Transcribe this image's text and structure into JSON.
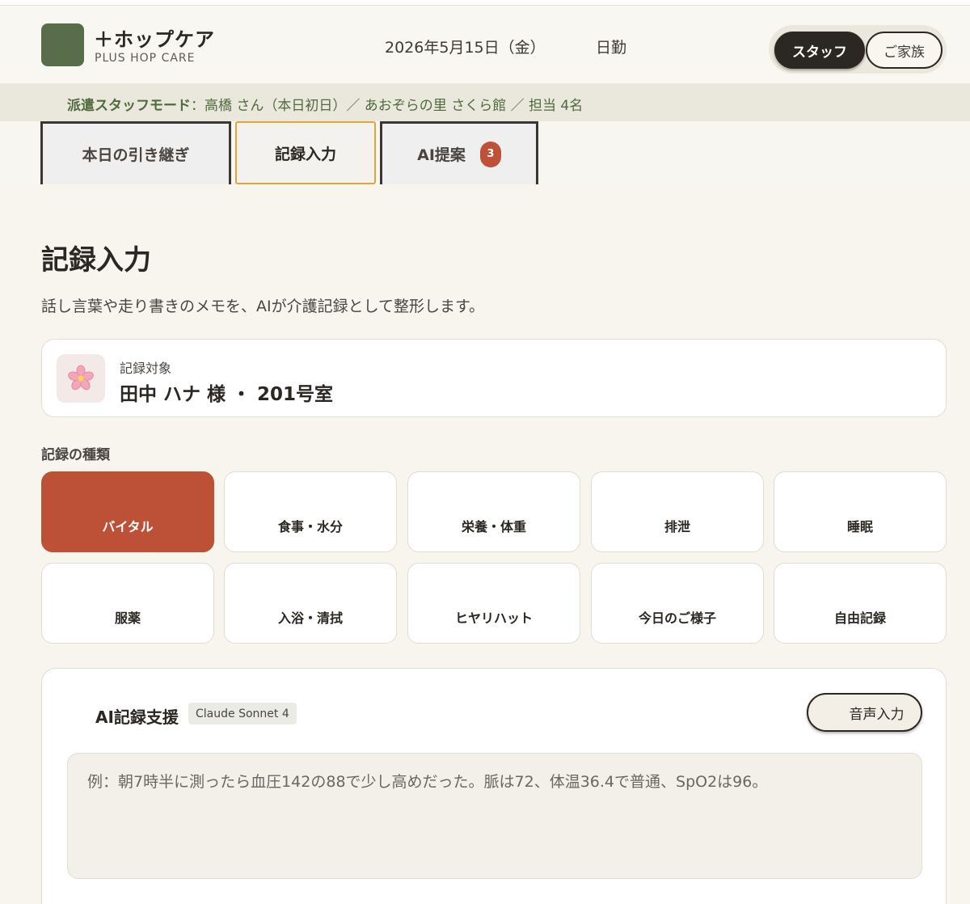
{
  "header": {
    "brand_name": "＋ホップケア",
    "brand_sub": "PLUS HOP CARE",
    "date": "2026年5月15日（金）",
    "shift": "日勤",
    "mode_staff": "スタッフ",
    "mode_family": "ご家族"
  },
  "banner": {
    "label": "派遣スタッフモード",
    "info": "：高橋 さん（本日初日）／ あおぞらの里 さくら館 ／ 担当 4名"
  },
  "tabs": [
    {
      "label": "本日の引き継ぎ"
    },
    {
      "label": "記録入力"
    },
    {
      "label": "AI提案",
      "badge": "3"
    }
  ],
  "page": {
    "title": "記録入力",
    "description": "話し言葉や走り書きのメモを、AIが介護記録として整形します。"
  },
  "target": {
    "label": "記録対象",
    "value": "田中 ハナ 様 ・ 201号室",
    "icon": "cherry-blossom-icon"
  },
  "record_types": {
    "label": "記録の種類",
    "items": [
      {
        "label": "バイタル",
        "active": true
      },
      {
        "label": "食事・水分"
      },
      {
        "label": "栄養・体重"
      },
      {
        "label": "排泄"
      },
      {
        "label": "睡眠"
      },
      {
        "label": "服薬"
      },
      {
        "label": "入浴・清拭"
      },
      {
        "label": "ヒヤリハット"
      },
      {
        "label": "今日のご様子"
      },
      {
        "label": "自由記録"
      }
    ]
  },
  "ai": {
    "title": "AI記録支援",
    "model": "Claude Sonnet 4",
    "voice_button": "音声入力",
    "input_value": "",
    "input_placeholder": "例：朝7時半に測ったら血圧142の88で少し高めだった。脈は72、体温36.4で普通、SpO2は96。"
  },
  "colors": {
    "brand_green": "#586e4a",
    "accent_red": "#bd5138",
    "tab_focus": "#e1a53c"
  }
}
